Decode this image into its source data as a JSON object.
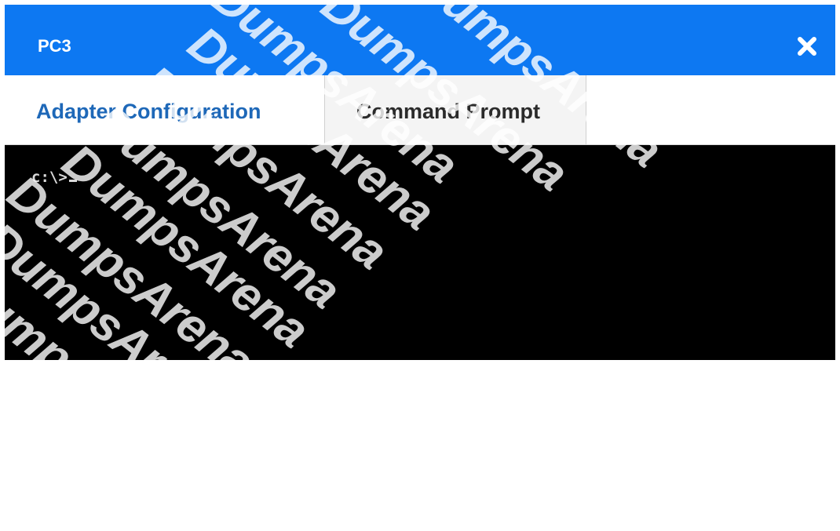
{
  "window": {
    "title": "PC3",
    "close_icon": "close-icon"
  },
  "tabs": [
    {
      "label": "Adapter Configuration",
      "state": "inactive"
    },
    {
      "label": "Command Prompt",
      "state": "active"
    }
  ],
  "console": {
    "prompt": "c:\\>"
  },
  "watermark": {
    "text": "DumpsArena"
  },
  "colors": {
    "titlebar": "#0d78f2",
    "tab_link": "#1e68b8",
    "console_bg": "#000000",
    "console_text": "#d9d9d9"
  }
}
